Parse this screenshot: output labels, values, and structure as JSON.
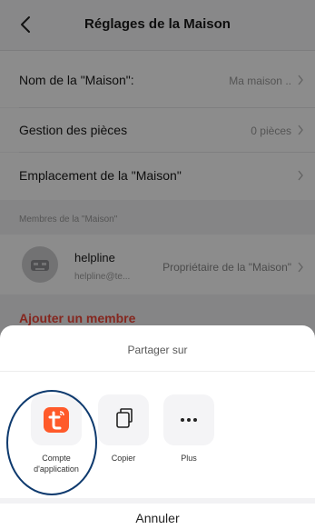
{
  "header": {
    "title": "Réglages de la Maison",
    "back_icon": "chevron-left-icon"
  },
  "settings": {
    "home_name": {
      "label": "Nom de la \"Maison\":",
      "value": "Ma maison .."
    },
    "rooms": {
      "label": "Gestion des pièces",
      "value": "0 pièces"
    },
    "location": {
      "label": "Emplacement de la \"Maison\""
    }
  },
  "members": {
    "section_label": "Membres de la \"Maison\"",
    "items": [
      {
        "name": "helpline",
        "email": "helpline@te...",
        "role": "Propriétaire de la \"Maison\""
      }
    ],
    "add_label": "Ajouter un membre"
  },
  "share_sheet": {
    "title": "Partager sur",
    "options": [
      {
        "label": "Compte d'application",
        "icon": "tuya-app-icon"
      },
      {
        "label": "Copier",
        "icon": "copy-icon"
      },
      {
        "label": "Plus",
        "icon": "more-icon"
      }
    ],
    "cancel_label": "Annuler"
  },
  "colors": {
    "accent": "#f2473a",
    "tuya_brand": "#ff5a2a",
    "highlight_ring": "#0e3a6e"
  }
}
